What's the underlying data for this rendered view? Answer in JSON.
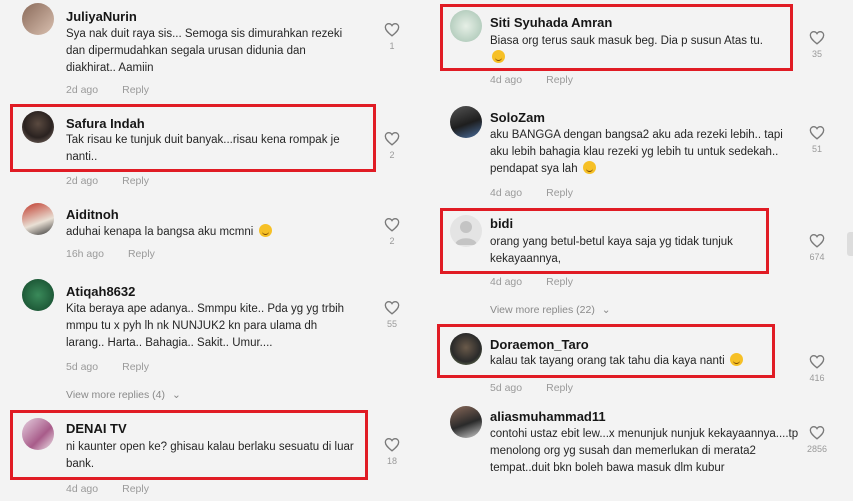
{
  "left": [
    {
      "id": "c1",
      "username": "JuliyaNurin",
      "text": "Sya nak duit raya sis... Semoga sis dimurahkan rezeki dan dipermudahkan segala urusan didunia dan diakhirat.. Aamiin",
      "time": "2d ago",
      "reply": "Reply",
      "likes": "1"
    },
    {
      "id": "c2",
      "username": "Safura Indah",
      "text": "Tak risau ke tunjuk duit banyak...risau kena rompak je nanti..",
      "time": "2d ago",
      "reply": "Reply",
      "likes": "2"
    },
    {
      "id": "c3",
      "username": "Aiditnoh",
      "text": "aduhai kenapa la bangsa aku mcmni",
      "time": "16h ago",
      "reply": "Reply",
      "likes": "2"
    },
    {
      "id": "c4",
      "username": "Atiqah8632",
      "text": "Kita beraya ape adanya.. Smmpu kite.. Pda yg yg trbih mmpu tu x pyh lh nk NUNJUK2 kn para ulama dh larang.. Harta.. Bahagia.. Sakit.. Umur....",
      "time": "5d ago",
      "reply": "Reply",
      "likes": "55",
      "view_more": "View more replies (4)"
    },
    {
      "id": "c5",
      "username": "DENAI TV",
      "text": "ni kaunter open ke? ghisau kalau berlaku sesuatu di luar bank.",
      "time": "4d ago",
      "reply": "Reply",
      "likes": "18"
    }
  ],
  "right": [
    {
      "id": "c6",
      "username": "Siti Syuhada Amran",
      "text": "Biasa org terus sauk masuk beg. Dia p susun Atas tu.",
      "time": "4d ago",
      "reply": "Reply",
      "likes": "35"
    },
    {
      "id": "c7",
      "username": "SoloZam",
      "text": "aku BANGGA dengan bangsa2 aku ada rezeki lebih.. tapi aku lebih bahagia klau rezeki yg lebih tu untuk sedekah.. pendapat sya lah",
      "time": "4d ago",
      "reply": "Reply",
      "likes": "51"
    },
    {
      "id": "c8",
      "username": "bidi",
      "text": "orang yang betul-betul kaya saja yg tidak tunjuk kekayaannya,",
      "time": "4d ago",
      "reply": "Reply",
      "likes": "674",
      "view_more": "View more replies (22)"
    },
    {
      "id": "c9",
      "username": "Doraemon_Taro",
      "text": "kalau tak tayang orang tak tahu dia kaya nanti",
      "time": "5d ago",
      "reply": "Reply",
      "likes": "416"
    },
    {
      "id": "c10",
      "username": "aliasmuhammad11",
      "text": "contohi ustaz ebit lew...x menunjuk nunjuk kekayaannya....tp menolong org yg susah dan memerlukan di merata2 tempat..duit bkn boleh bawa masuk dlm kubur",
      "time": "",
      "reply": "",
      "likes": "2856"
    }
  ],
  "colors": {
    "highlight": "#e01b24",
    "background": "#f3f3f3",
    "meta": "#9a9a9a"
  },
  "icons": {
    "like": "heart-outline-icon",
    "view_more": "chevron-down-icon",
    "emoji": "smile-emoji-icon"
  }
}
